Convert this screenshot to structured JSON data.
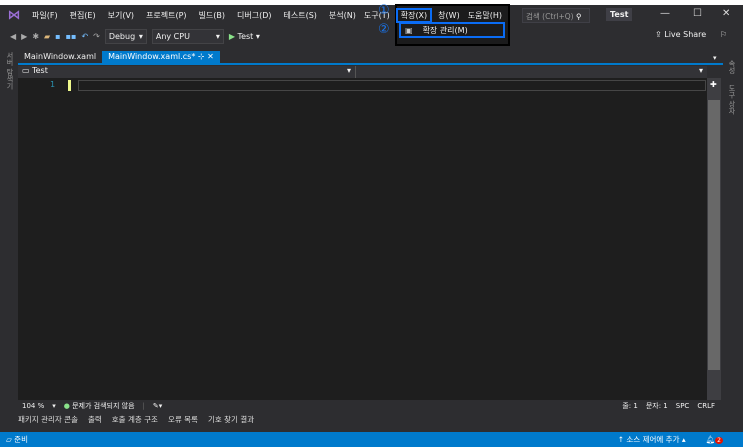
{
  "menu": [
    "파일(F)",
    "편집(E)",
    "보기(V)",
    "프로젝트(P)",
    "빌드(B)",
    "디버그(D)",
    "테스트(S)",
    "분석(N)",
    "도구(T)",
    "확장(X)",
    "창(W)",
    "도움말(H)"
  ],
  "search_placeholder": "검색 (Ctrl+Q)",
  "solution_title": "Test",
  "toolbar": {
    "config": "Debug",
    "platform": "Any CPU",
    "run": "Test",
    "live_share": "Live Share"
  },
  "dropdown": {
    "item": "확장 관리(M)"
  },
  "annotations": {
    "step1": "①",
    "step2": "②"
  },
  "left_rail": "서버 탐색기",
  "right_rail": [
    "속성",
    "도구 상자"
  ],
  "tabs": [
    {
      "label": "MainWindow.xaml"
    },
    {
      "label": "MainWindow.xaml.cs*"
    }
  ],
  "navbar": {
    "scope": "Test"
  },
  "editor": {
    "line_number": "1"
  },
  "editor_status": {
    "zoom": "104 %",
    "issues": "문제가 검색되지 않음",
    "line": "줄: 1",
    "col": "문자: 1",
    "spc": "SPC",
    "crlf": "CRLF"
  },
  "bottom_tabs": [
    "패키지 관리자 콘솔",
    "출력",
    "호출 계층 구조",
    "오류 목록",
    "기호 찾기 결과"
  ],
  "status": {
    "ready": "준비",
    "source_control": "소스 제어에 추가",
    "notifications": "2"
  }
}
